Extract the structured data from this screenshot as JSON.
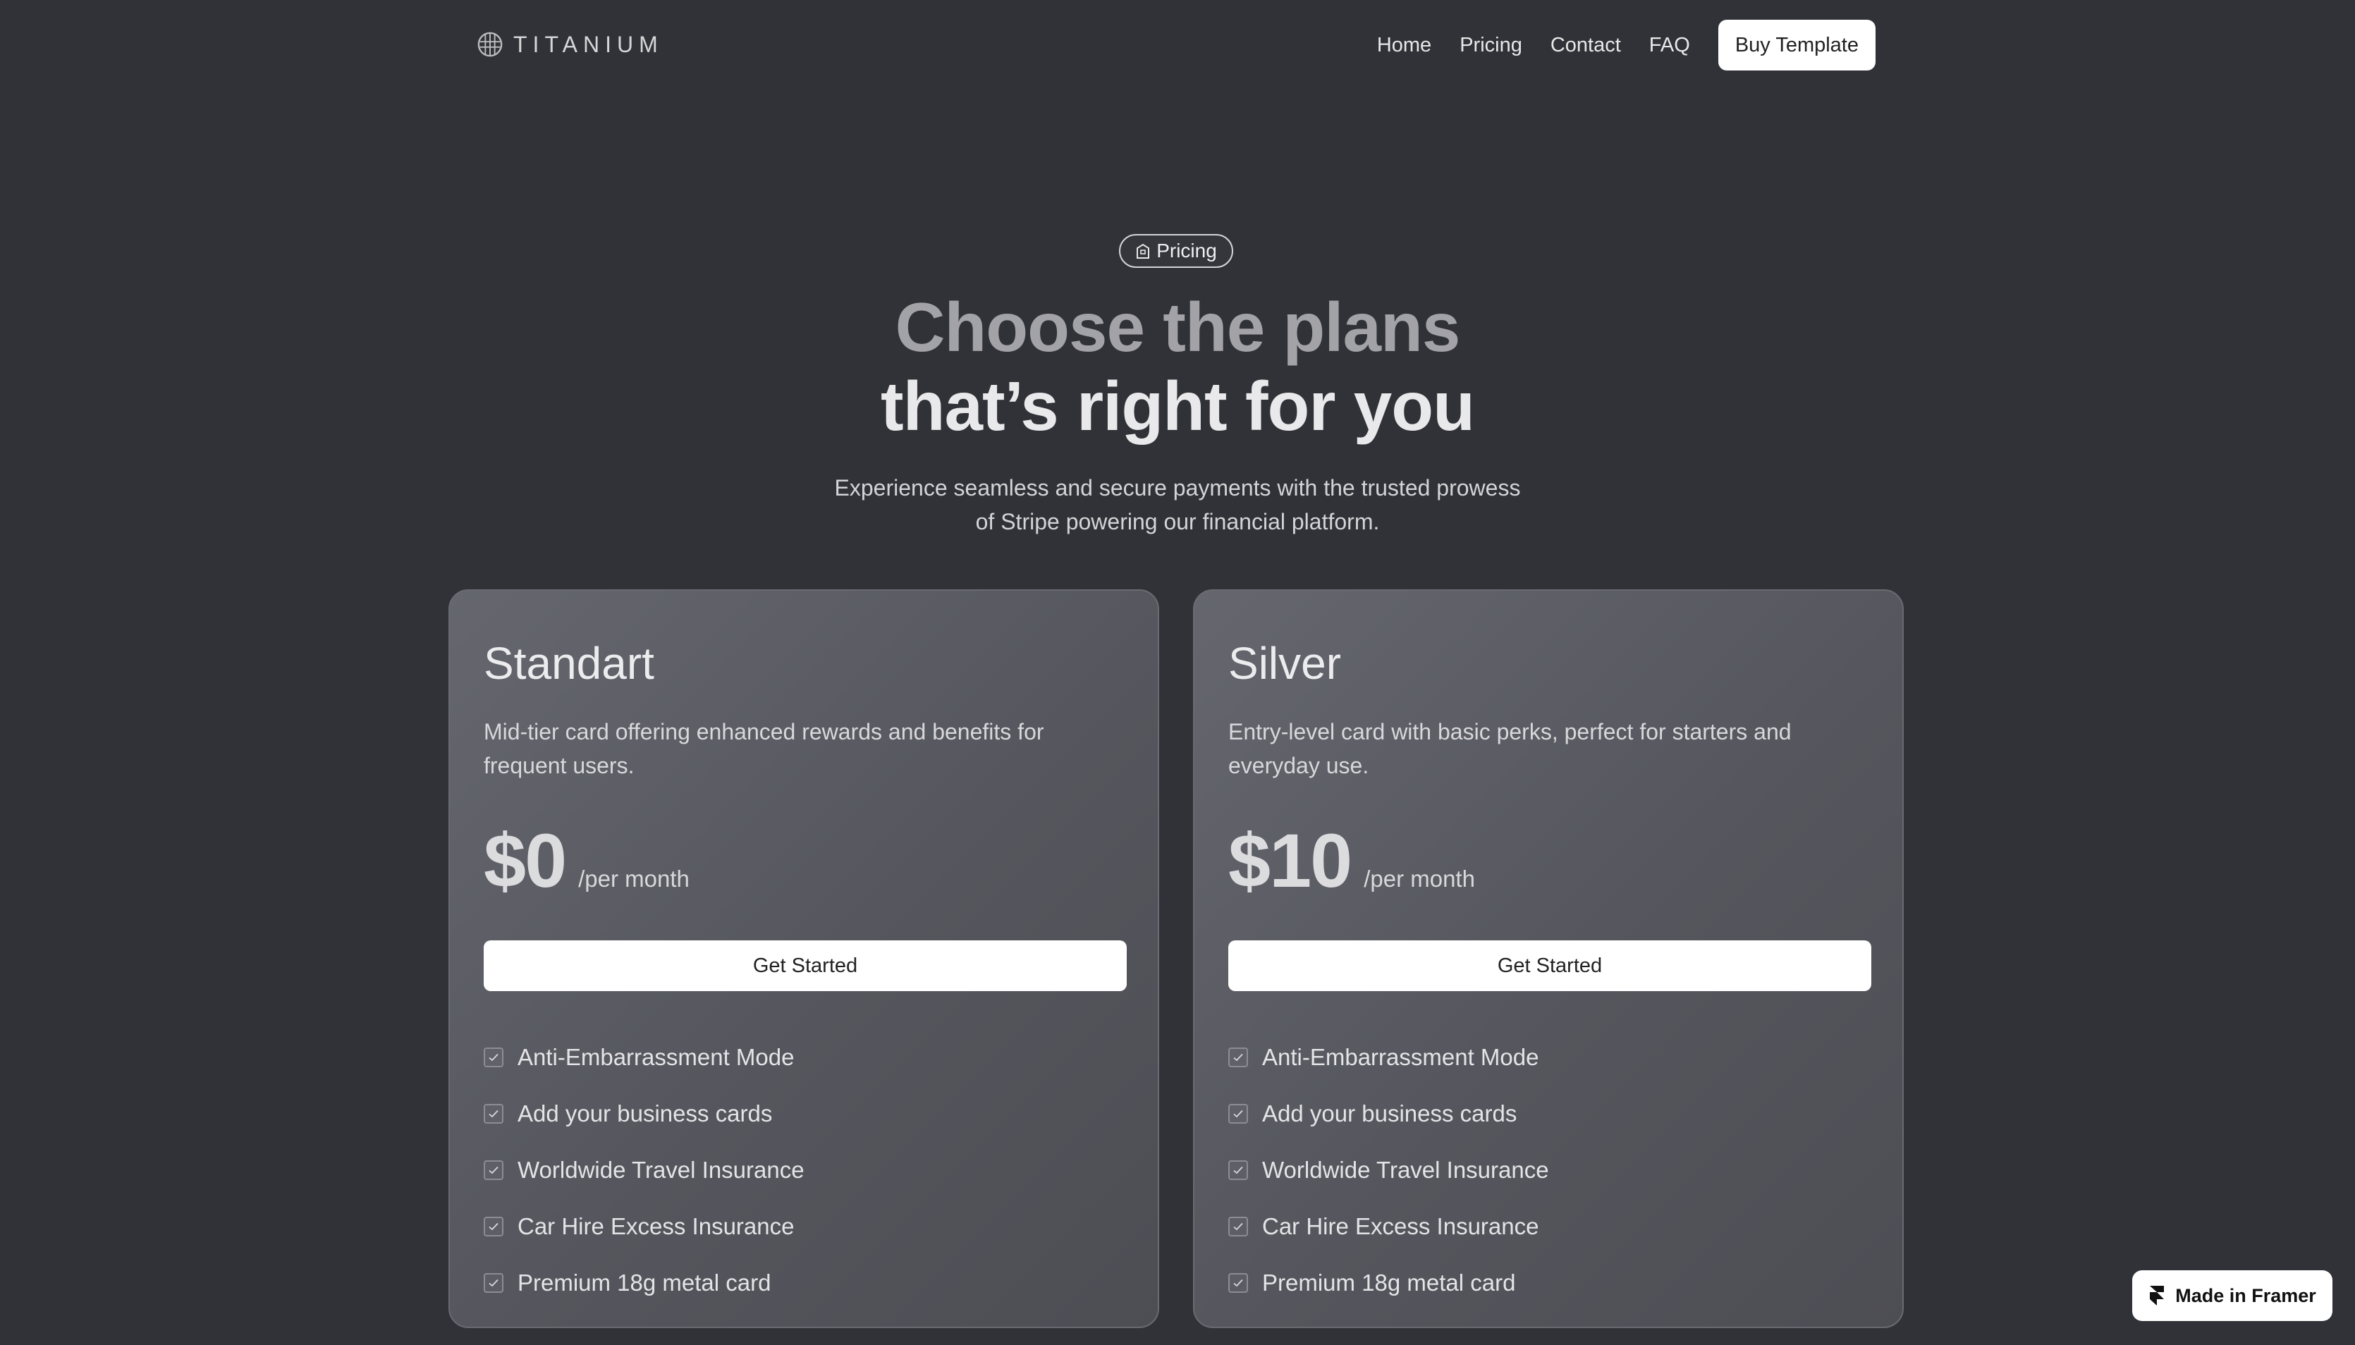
{
  "nav": {
    "logo_text": "TITANIUM",
    "links": [
      "Home",
      "Pricing",
      "Contact",
      "FAQ"
    ],
    "buy_label": "Buy Template"
  },
  "hero": {
    "badge": "Pricing",
    "headline_line1": "Choose the plans",
    "headline_line2": "that’s right for you",
    "subtitle": "Experience seamless and secure payments with the trusted prowess of Stripe powering our financial platform."
  },
  "plans": [
    {
      "name": "Standart",
      "description": "Mid-tier card offering enhanced rewards and benefits for frequent users.",
      "price": "$0",
      "period": "/per month",
      "cta": "Get Started",
      "features": [
        "Anti-Embarrassment Mode",
        "Add your business cards",
        "Worldwide Travel Insurance",
        "Car Hire Excess Insurance",
        "Premium 18g metal card"
      ]
    },
    {
      "name": "Silver",
      "description": "Entry-level card with basic perks, perfect for starters and everyday use.",
      "price": "$10",
      "period": "/per month",
      "cta": "Get Started",
      "features": [
        "Anti-Embarrassment Mode",
        "Add your business cards",
        "Worldwide Travel Insurance",
        "Car Hire Excess Insurance",
        "Premium 18g metal card"
      ]
    }
  ],
  "framer_badge": "Made in Framer",
  "icons": {
    "logo": "titanium-logo-icon",
    "badge": "building-icon",
    "feature": "check-icon",
    "framer": "framer-icon"
  },
  "colors": {
    "background": "#313237",
    "card": "#5c5d64",
    "button": "#ffffff"
  }
}
